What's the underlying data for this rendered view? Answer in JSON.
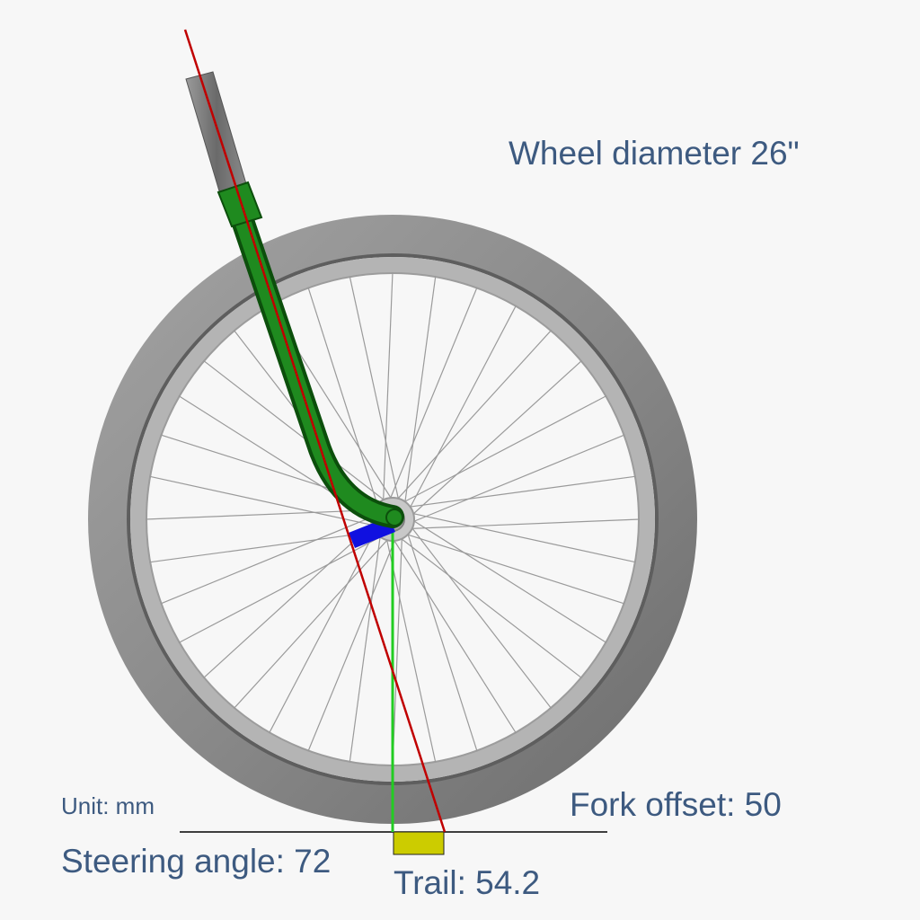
{
  "labels": {
    "wheel_diameter": "Wheel diameter 26\"",
    "unit": "Unit: mm",
    "fork_offset": "Fork offset: 50",
    "steering_angle": "Steering angle: 72",
    "trail": "Trail: 54.2"
  },
  "geometry": {
    "wheel_diameter_in": 26,
    "fork_offset_mm": 50,
    "steering_angle_deg": 72,
    "trail_mm": 54.2,
    "spoke_count": 36
  },
  "colors": {
    "steering_axis": "#c00000",
    "fork": "#1f8a1f",
    "offset_marker": "#1010e0",
    "vertical_line": "#22cc22",
    "trail_marker": "#cccc00",
    "tire": "#8a8a8a",
    "rim": "#b4b4b4",
    "spokes": "#9a9a9a",
    "steerer": "#7a7a7a",
    "ground": "#000000",
    "text": "#3d5a80"
  }
}
